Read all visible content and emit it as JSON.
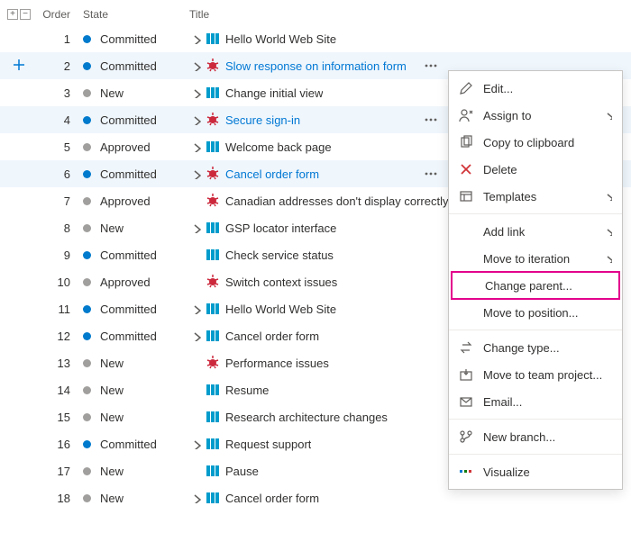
{
  "columns": {
    "order": "Order",
    "state": "State",
    "title": "Title"
  },
  "state_colors": {
    "Committed": "dot-blue",
    "New": "dot-grey",
    "Approved": "dot-grey"
  },
  "rows": [
    {
      "order": 1,
      "state": "Committed",
      "icon": "pbi",
      "title": "Hello World Web Site",
      "chev": true,
      "sel": false,
      "link": false
    },
    {
      "order": 2,
      "state": "Committed",
      "icon": "bug",
      "title": "Slow response on information form",
      "chev": true,
      "sel": true,
      "link": true,
      "ell": true
    },
    {
      "order": 3,
      "state": "New",
      "icon": "pbi",
      "title": "Change initial view",
      "chev": true,
      "sel": false,
      "link": false
    },
    {
      "order": 4,
      "state": "Committed",
      "icon": "bug",
      "title": "Secure sign-in",
      "chev": true,
      "sel": true,
      "link": true,
      "ell": true
    },
    {
      "order": 5,
      "state": "Approved",
      "icon": "pbi",
      "title": "Welcome back page",
      "chev": true,
      "sel": false,
      "link": false
    },
    {
      "order": 6,
      "state": "Committed",
      "icon": "bug",
      "title": "Cancel order form",
      "chev": true,
      "sel": true,
      "link": true,
      "ell": true
    },
    {
      "order": 7,
      "state": "Approved",
      "icon": "bug",
      "title": "Canadian addresses don't display correctly",
      "chev": false,
      "sel": false,
      "link": false
    },
    {
      "order": 8,
      "state": "New",
      "icon": "pbi",
      "title": "GSP locator interface",
      "chev": true,
      "sel": false,
      "link": false
    },
    {
      "order": 9,
      "state": "Committed",
      "icon": "pbi",
      "title": "Check service status",
      "chev": false,
      "sel": false,
      "link": false
    },
    {
      "order": 10,
      "state": "Approved",
      "icon": "bug",
      "title": "Switch context issues",
      "chev": false,
      "sel": false,
      "link": false
    },
    {
      "order": 11,
      "state": "Committed",
      "icon": "pbi",
      "title": "Hello World Web Site",
      "chev": true,
      "sel": false,
      "link": false
    },
    {
      "order": 12,
      "state": "Committed",
      "icon": "pbi",
      "title": "Cancel order form",
      "chev": true,
      "sel": false,
      "link": false
    },
    {
      "order": 13,
      "state": "New",
      "icon": "bug",
      "title": "Performance issues",
      "chev": false,
      "sel": false,
      "link": false
    },
    {
      "order": 14,
      "state": "New",
      "icon": "pbi",
      "title": "Resume",
      "chev": false,
      "sel": false,
      "link": false
    },
    {
      "order": 15,
      "state": "New",
      "icon": "pbi",
      "title": "Research architecture changes",
      "chev": false,
      "sel": false,
      "link": false
    },
    {
      "order": 16,
      "state": "Committed",
      "icon": "pbi",
      "title": "Request support",
      "chev": true,
      "sel": false,
      "link": false
    },
    {
      "order": 17,
      "state": "New",
      "icon": "pbi",
      "title": "Pause",
      "chev": false,
      "sel": false,
      "link": false
    },
    {
      "order": 18,
      "state": "New",
      "icon": "pbi",
      "title": "Cancel order form",
      "chev": true,
      "sel": false,
      "link": false
    }
  ],
  "menu": [
    {
      "type": "item",
      "icon": "edit",
      "label": "Edit...",
      "sub": false
    },
    {
      "type": "item",
      "icon": "assign",
      "label": "Assign to",
      "sub": true
    },
    {
      "type": "item",
      "icon": "copy",
      "label": "Copy to clipboard",
      "sub": false
    },
    {
      "type": "item",
      "icon": "delete",
      "label": "Delete",
      "sub": false,
      "red": true
    },
    {
      "type": "item",
      "icon": "templates",
      "label": "Templates",
      "sub": true
    },
    {
      "type": "sep"
    },
    {
      "type": "item",
      "icon": "",
      "label": "Add link",
      "sub": true
    },
    {
      "type": "item",
      "icon": "",
      "label": "Move to iteration",
      "sub": true
    },
    {
      "type": "item",
      "icon": "",
      "label": "Change parent...",
      "sub": false,
      "hl": true
    },
    {
      "type": "item",
      "icon": "",
      "label": "Move to position...",
      "sub": false
    },
    {
      "type": "sep"
    },
    {
      "type": "item",
      "icon": "swap",
      "label": "Change type...",
      "sub": false
    },
    {
      "type": "item",
      "icon": "move",
      "label": "Move to team project...",
      "sub": false
    },
    {
      "type": "item",
      "icon": "mail",
      "label": "Email...",
      "sub": false
    },
    {
      "type": "sep"
    },
    {
      "type": "item",
      "icon": "branch",
      "label": "New branch...",
      "sub": false
    },
    {
      "type": "sep"
    },
    {
      "type": "item",
      "icon": "visualize",
      "label": "Visualize",
      "sub": false
    }
  ]
}
